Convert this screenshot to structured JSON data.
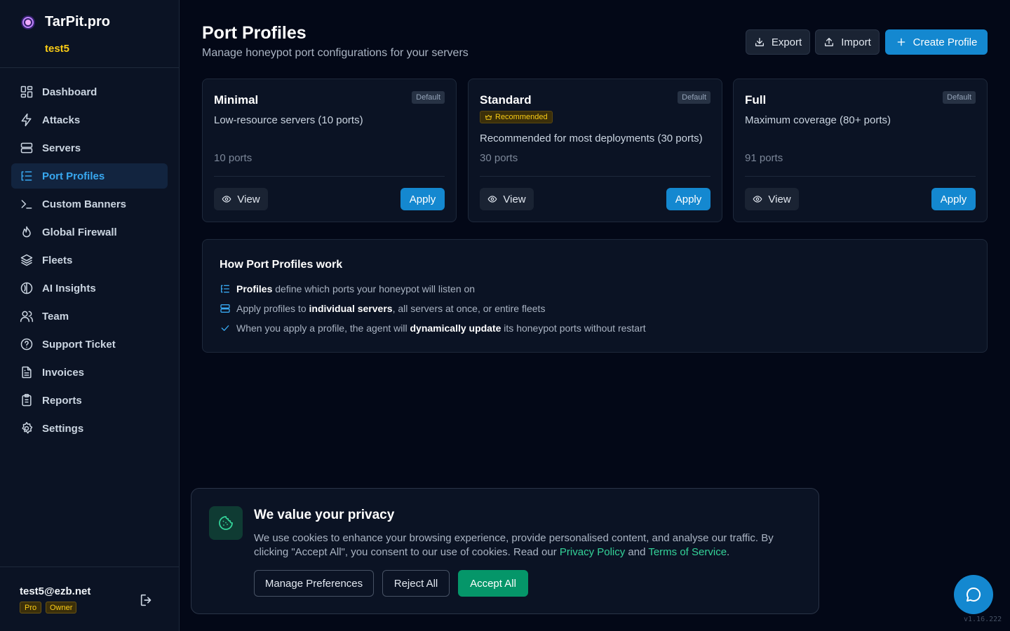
{
  "brand": {
    "name": "TarPit.pro",
    "user": "test5"
  },
  "sidebar": {
    "items": [
      {
        "label": "Dashboard",
        "icon": "grid-icon"
      },
      {
        "label": "Attacks",
        "icon": "bolt-icon"
      },
      {
        "label": "Servers",
        "icon": "server-icon"
      },
      {
        "label": "Port Profiles",
        "icon": "list-tree-icon",
        "active": true
      },
      {
        "label": "Custom Banners",
        "icon": "terminal-icon"
      },
      {
        "label": "Global Firewall",
        "icon": "flame-icon"
      },
      {
        "label": "Fleets",
        "icon": "layers-icon"
      },
      {
        "label": "AI Insights",
        "icon": "brain-icon"
      },
      {
        "label": "Team",
        "icon": "users-icon"
      },
      {
        "label": "Support Ticket",
        "icon": "help-circle-icon"
      },
      {
        "label": "Invoices",
        "icon": "file-text-icon"
      },
      {
        "label": "Reports",
        "icon": "clipboard-icon"
      },
      {
        "label": "Settings",
        "icon": "gear-icon"
      }
    ],
    "footer": {
      "email": "test5@ezb.net",
      "plan": "Pro",
      "role": "Owner"
    }
  },
  "header": {
    "title": "Port Profiles",
    "subtitle": "Manage honeypot port configurations for your servers",
    "export_label": "Export",
    "import_label": "Import",
    "create_label": "Create Profile"
  },
  "profiles": [
    {
      "name": "Minimal",
      "badge": "Default",
      "description": "Low-resource servers (10 ports)",
      "ports": "10 ports",
      "view_label": "View",
      "apply_label": "Apply"
    },
    {
      "name": "Standard",
      "badge": "Default",
      "recommended": "Recommended",
      "description": "Recommended for most deployments (30 ports)",
      "ports": "30 ports",
      "view_label": "View",
      "apply_label": "Apply"
    },
    {
      "name": "Full",
      "badge": "Default",
      "description": "Maximum coverage (80+ ports)",
      "ports": "91 ports",
      "view_label": "View",
      "apply_label": "Apply"
    }
  ],
  "info": {
    "title": "How Port Profiles work",
    "row1": {
      "bold": "Profiles",
      "rest": " define which ports your honeypot will listen on"
    },
    "row2": {
      "pre": "Apply profiles to ",
      "bold": "individual servers",
      "rest": ", all servers at once, or entire fleets"
    },
    "row3": {
      "pre": "When you apply a profile, the agent will ",
      "bold": "dynamically update",
      "rest": " its honeypot ports without restart"
    }
  },
  "cookie": {
    "title": "We value your privacy",
    "text_before": "We use cookies to enhance your browsing experience, provide personalised content, and analyse our traffic. By clicking \"Accept All\", you consent to our use of cookies. Read our ",
    "privacy_link": "Privacy Policy",
    "and": " and ",
    "terms_link": "Terms of Service",
    "end": ".",
    "manage_label": "Manage Preferences",
    "reject_label": "Reject All",
    "accept_label": "Accept All"
  },
  "version": "v1.16.222",
  "colors": {
    "accent": "#1488d0",
    "active_text": "#38a8f0",
    "success": "#059669",
    "warning": "#facc15"
  }
}
